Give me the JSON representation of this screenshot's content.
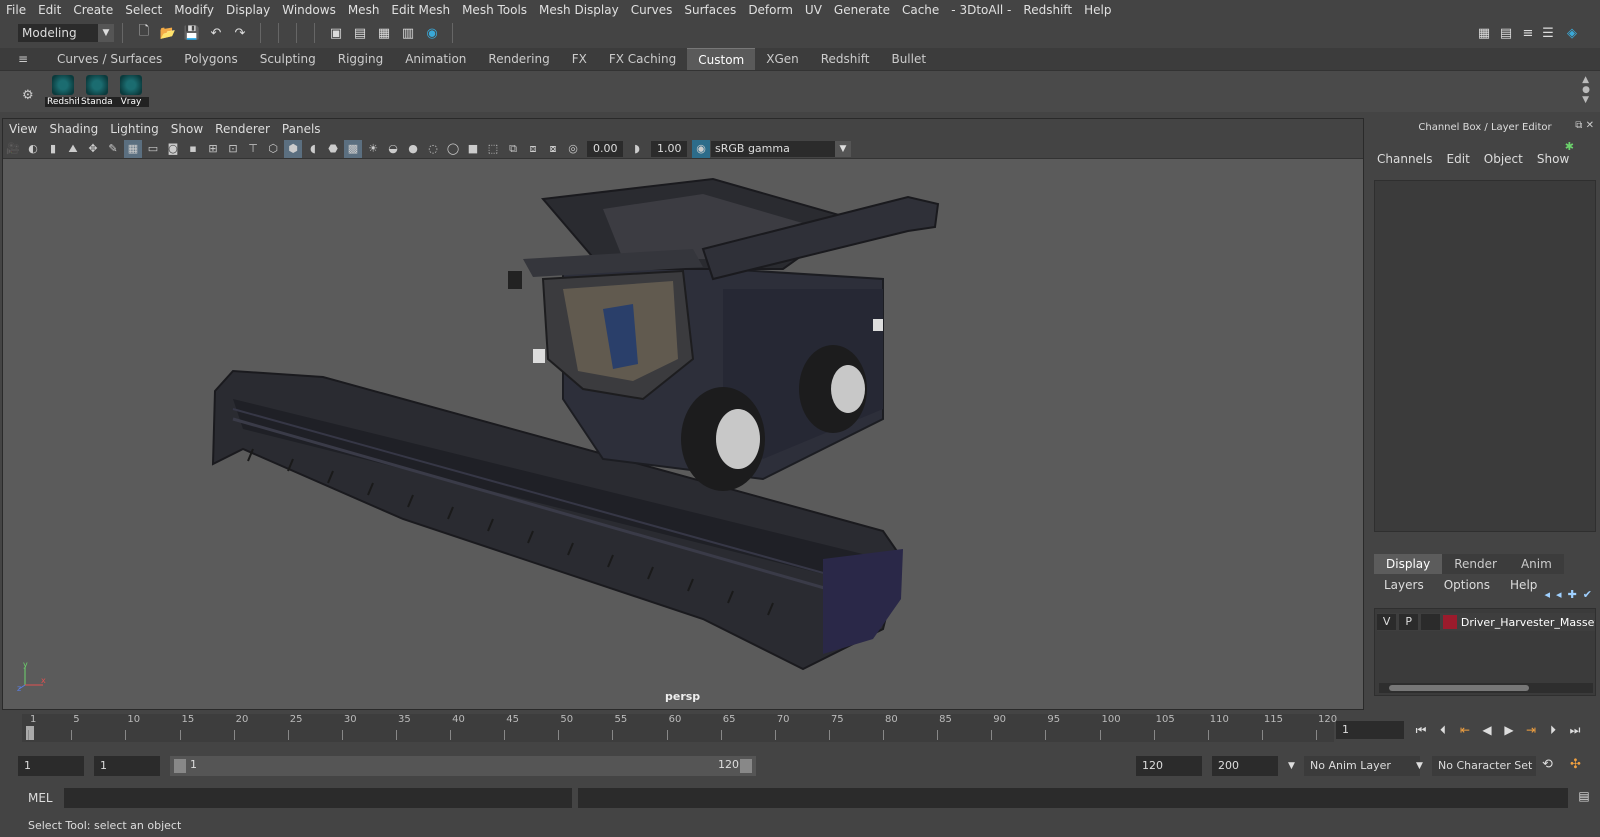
{
  "menubar": [
    "File",
    "Edit",
    "Create",
    "Select",
    "Modify",
    "Display",
    "Windows",
    "Mesh",
    "Edit Mesh",
    "Mesh Tools",
    "Mesh Display",
    "Curves",
    "Surfaces",
    "Deform",
    "UV",
    "Generate",
    "Cache",
    "- 3DtoAll -",
    "Redshift",
    "Help"
  ],
  "mode": "Modeling",
  "shelf_tabs": [
    "Curves / Surfaces",
    "Polygons",
    "Sculpting",
    "Rigging",
    "Animation",
    "Rendering",
    "FX",
    "FX Caching",
    "Custom",
    "XGen",
    "Redshift",
    "Bullet"
  ],
  "shelf_active": "Custom",
  "shelf_items": [
    "Redshif",
    "Standar",
    "Vray"
  ],
  "viewport": {
    "menu": [
      "View",
      "Shading",
      "Lighting",
      "Show",
      "Renderer",
      "Panels"
    ],
    "exposure": "0.00",
    "gamma_value": "1.00",
    "color_space": "sRGB gamma",
    "camera_label": "persp"
  },
  "right_panel": {
    "title": "Channel Box / Layer Editor",
    "menu": [
      "Channels",
      "Edit",
      "Object",
      "Show"
    ],
    "layer_tabs": [
      "Display",
      "Render",
      "Anim"
    ],
    "layer_tab_active": "Display",
    "layer_menu": [
      "Layers",
      "Options",
      "Help"
    ],
    "layer": {
      "v": "V",
      "p": "P",
      "name": "Driver_Harvester_Massey",
      "color": "#9b1b2c"
    }
  },
  "timeline": {
    "ticks": [
      1,
      5,
      10,
      15,
      20,
      25,
      30,
      35,
      40,
      45,
      50,
      55,
      60,
      65,
      70,
      75,
      80,
      85,
      90,
      95,
      100,
      105,
      110,
      115,
      120
    ],
    "current_frame": "1"
  },
  "range": {
    "start": "1",
    "playback_start": "1",
    "slider_start": "1",
    "slider_end": "120",
    "end": "120",
    "anim_end": "200",
    "anim_layer": "No Anim Layer",
    "character_set": "No Character Set"
  },
  "mel_label": "MEL",
  "status": "Select Tool: select an object"
}
